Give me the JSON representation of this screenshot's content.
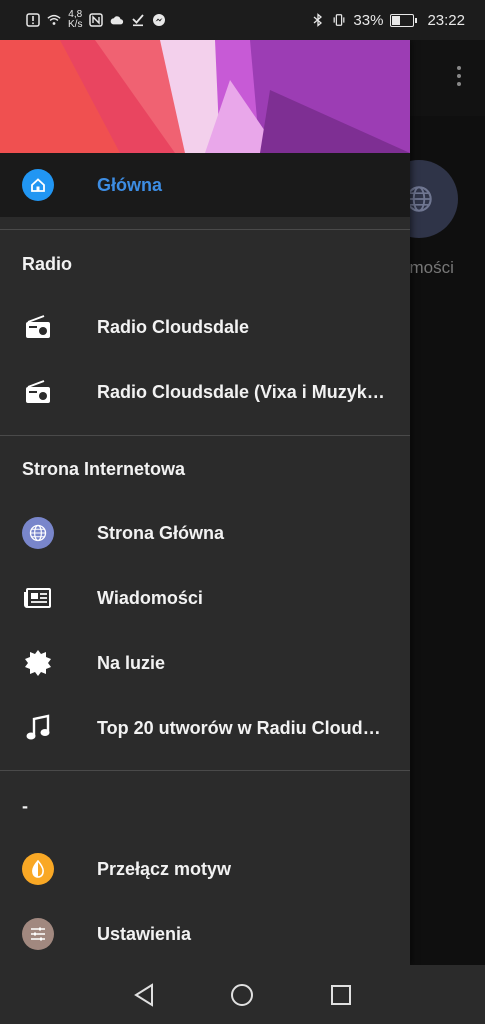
{
  "status_bar": {
    "net_speed_value": "4,8",
    "net_speed_unit": "K/s",
    "battery": "33%",
    "battery_level": 0.33,
    "time": "23:22"
  },
  "background": {
    "label": "omości"
  },
  "drawer": {
    "home": {
      "label": "Główna"
    },
    "sections": {
      "radio": {
        "title": "Radio",
        "items": [
          "Radio Cloudsdale",
          "Radio Cloudsdale (Vixa i Muzyka…"
        ]
      },
      "website": {
        "title": "Strona Internetowa",
        "items": [
          "Strona Główna",
          "Wiadomości",
          "Na luzie",
          "Top 20 utworów w Radiu Clouds…"
        ]
      },
      "other": {
        "title": "-",
        "items": [
          "Przełącz motyw",
          "Ustawienia"
        ]
      }
    }
  },
  "colors": {
    "accent_blue": "#3d8de3",
    "home_icon_bg": "#2196f3",
    "globe_icon_bg": "#7986cb",
    "theme_icon_bg": "#f9a825",
    "settings_icon_bg": "#a1887f"
  },
  "icons": [
    "home-icon",
    "radio-icon",
    "globe-icon",
    "newspaper-icon",
    "badge-icon",
    "music-note-icon",
    "theme-toggle-icon",
    "settings-sliders-icon",
    "back-icon",
    "home-nav-icon",
    "recents-icon"
  ]
}
